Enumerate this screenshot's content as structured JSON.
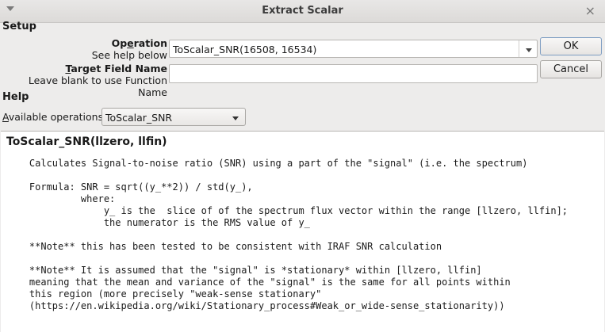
{
  "window": {
    "title": "Extract Scalar",
    "close_glyph": "×",
    "icons": {
      "menu": "chevron-down-icon",
      "close": "close-icon"
    }
  },
  "setup": {
    "section_label": "Setup",
    "operation_label_pre": "Op",
    "operation_label_mnemonic": "e",
    "operation_label_post": "ration",
    "operation_sublabel": "See help below",
    "operation_value": "ToScalar_SNR(16508, 16534)",
    "target_label_pre": "",
    "target_label_mnemonic": "T",
    "target_label_post": "arget Field Name",
    "target_sublabel": "Leave blank to use Function Name",
    "target_value": ""
  },
  "buttons": {
    "ok": "OK",
    "cancel": "Cancel"
  },
  "help": {
    "section_label": "Help",
    "available_label_pre": "",
    "available_label_mnemonic": "A",
    "available_label_post": "vailable operations",
    "available_selected": "ToScalar_SNR",
    "title": "ToScalar_SNR(llzero, llfin)",
    "body": "    Calculates Signal-to-noise ratio (SNR) using a part of the \"signal\" (i.e. the spectrum)\n\n    Formula: SNR = sqrt((y_**2)) / std(y_),\n             where:\n                 y_ is the  slice of of the spectrum flux vector within the range [llzero, llfin];\n                 the numerator is the RMS value of y_\n\n    **Note** this has been tested to be consistent with IRAF SNR calculation\n\n    **Note** It is assumed that the \"signal\" is *stationary* within [llzero, llfin]\n    meaning that the mean and variance of the \"signal\" is the same for all points within\n    this region (more precisely \"weak-sense stationary\"\n    (https://en.wikipedia.org/wiki/Stationary_process#Weak_or_wide-sense_stationarity))"
  }
}
